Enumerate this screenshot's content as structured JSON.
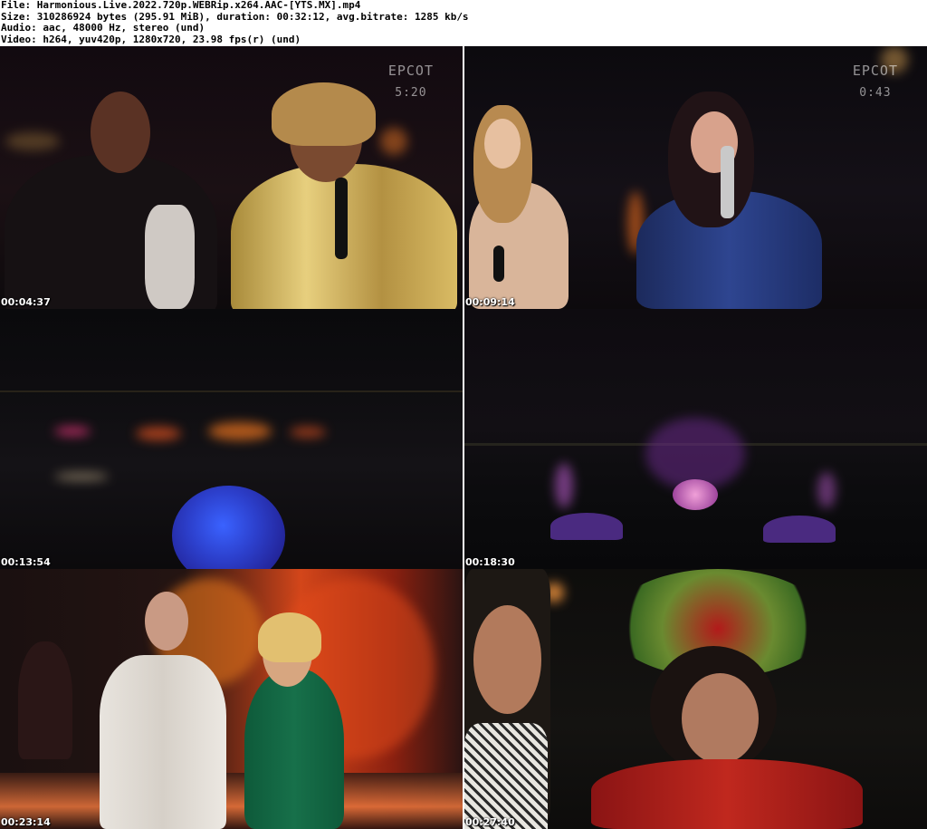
{
  "header": {
    "file": "File: Harmonious.Live.2022.720p.WEBRip.x264.AAC-[YTS.MX].mp4",
    "size": "Size: 310286924 bytes (295.91 MiB), duration: 00:32:12, avg.bitrate: 1285 kb/s",
    "audio": "Audio: aac, 48000 Hz, stereo (und)",
    "video": "Video: h264, yuv420p, 1280x720, 23.98 fps(r) (und)"
  },
  "tiles": [
    {
      "timestamp": "00:04:37",
      "bug": "EPCOT",
      "clock": "5:20"
    },
    {
      "timestamp": "00:09:14",
      "bug": "EPCOT",
      "clock": "0:43"
    },
    {
      "timestamp": "00:13:54"
    },
    {
      "timestamp": "00:18:30"
    },
    {
      "timestamp": "00:23:14"
    },
    {
      "timestamp": "00:27:40"
    }
  ]
}
